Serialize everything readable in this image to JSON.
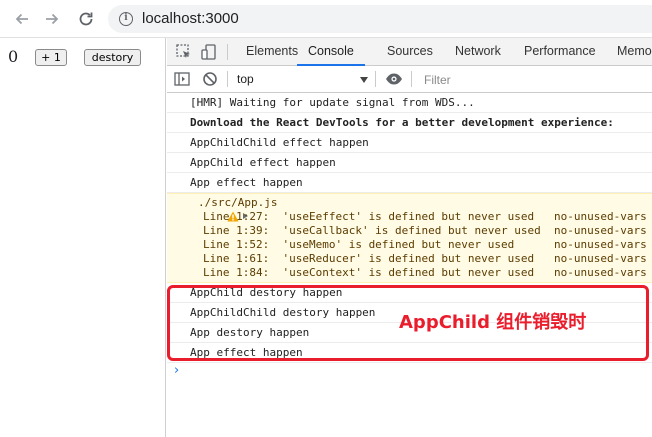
{
  "browser": {
    "url": "localhost:3000",
    "back_icon": "arrow-left",
    "forward_icon": "arrow-right",
    "reload_icon": "reload",
    "info_glyph": "i"
  },
  "page": {
    "counter": "0",
    "increment_label": "+ 1",
    "destroy_label": "destory"
  },
  "devtools": {
    "tabs": [
      "Elements",
      "Console",
      "Sources",
      "Network",
      "Performance",
      "Memo"
    ],
    "active_tab": "Console",
    "context": "top",
    "filter_placeholder": "Filter"
  },
  "console": {
    "messages": [
      {
        "text": "[HMR] Waiting for update signal from WDS...",
        "bold": false
      },
      {
        "text": "Download the React DevTools for a better development experience: ",
        "bold": true
      },
      {
        "text": "AppChildChild effect happen",
        "bold": false
      },
      {
        "text": "AppChild effect happen",
        "bold": false
      },
      {
        "text": "App effect happen",
        "bold": false
      }
    ],
    "warning": {
      "source": "./src/App.js",
      "lines": [
        "Line 1:27:  'useEeffect' is defined but never used   no-unused-vars",
        "Line 1:39:  'useCallback' is defined but never used  no-unused-vars",
        "Line 1:52:  'useMemo' is defined but never used      no-unused-vars",
        "Line 1:61:  'useReducer' is defined but never used   no-unused-vars",
        "Line 1:84:  'useContext' is defined but never used   no-unused-vars"
      ]
    },
    "after_messages": [
      {
        "text": "AppChild destory happen"
      },
      {
        "text": "AppChildChild destory happen"
      },
      {
        "text": "App destory happen"
      },
      {
        "text": "App effect happen"
      }
    ],
    "prompt": "›"
  },
  "annotation": {
    "label": "AppChild 组件销毁时",
    "color": "#ea1d2c"
  },
  "colors": {
    "accent": "#1a73e8",
    "warning_bg": "#fffbe5",
    "warning_text": "#5c3c00"
  }
}
